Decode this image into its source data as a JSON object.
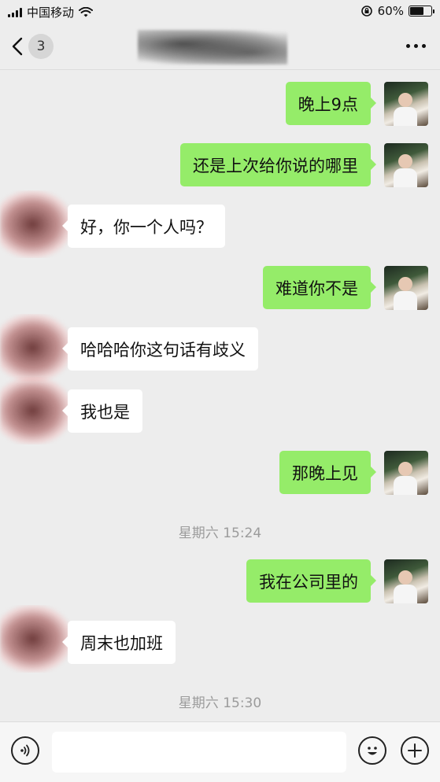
{
  "status_bar": {
    "carrier": "中国移动",
    "battery_percent": "60%",
    "battery_level": 0.6
  },
  "nav": {
    "back_icon": "chevron-left-icon",
    "unread_count": "3",
    "more_icon": "more-dots-icon"
  },
  "messages": [
    {
      "side": "me",
      "text": "晚上9点"
    },
    {
      "side": "me",
      "text": "还是上次给你说的哪里"
    },
    {
      "side": "other",
      "text": "好，你一个人吗？"
    },
    {
      "side": "me",
      "text": "难道你不是"
    },
    {
      "side": "other",
      "text": "哈哈哈你这句话有歧义"
    },
    {
      "side": "other",
      "text": "我也是"
    },
    {
      "side": "me",
      "text": "那晚上见"
    },
    {
      "side": "me",
      "text": "我在公司里的"
    },
    {
      "side": "other",
      "text": "周末也加班"
    }
  ],
  "timestamps": [
    "星期六 15:24",
    "星期六 15:30"
  ],
  "input_bar": {
    "voice_icon": "voice-icon",
    "emoji_icon": "emoji-icon",
    "plus_icon": "plus-icon",
    "draft": ""
  },
  "colors": {
    "background": "#ededed",
    "my_bubble": "#95ec69",
    "their_bubble": "#ffffff",
    "timestamp": "#9b9b9b"
  }
}
